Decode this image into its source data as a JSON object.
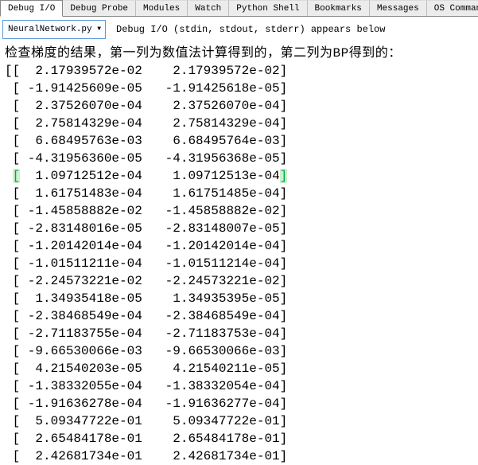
{
  "tabs": {
    "items": [
      {
        "label": "Debug I/O",
        "active": true
      },
      {
        "label": "Debug Probe",
        "active": false
      },
      {
        "label": "Modules",
        "active": false
      },
      {
        "label": "Watch",
        "active": false
      },
      {
        "label": "Python Shell",
        "active": false
      },
      {
        "label": "Bookmarks",
        "active": false
      },
      {
        "label": "Messages",
        "active": false
      },
      {
        "label": "OS Commands",
        "active": false
      }
    ]
  },
  "toolbar": {
    "process_selector": {
      "value": "NeuralNetwork.py (j",
      "arrow": "▼"
    },
    "description": "Debug I/O (stdin, stdout, stderr) appears below"
  },
  "output": {
    "header": "检查梯度的结果，第一列为数值法计算得到的，第二列为BP得到的：",
    "open_first": "[[",
    "open_rest": " [",
    "close": "]",
    "highlight_row_index": 6,
    "rows": [
      [
        "2.17939572e-02",
        "2.17939572e-02"
      ],
      [
        "-1.91425609e-05",
        "-1.91425618e-05"
      ],
      [
        "2.37526070e-04",
        "2.37526070e-04"
      ],
      [
        "2.75814329e-04",
        "2.75814329e-04"
      ],
      [
        "6.68495763e-03",
        "6.68495764e-03"
      ],
      [
        "-4.31956360e-05",
        "-4.31956368e-05"
      ],
      [
        "1.09712512e-04",
        "1.09712513e-04"
      ],
      [
        "1.61751483e-04",
        "1.61751485e-04"
      ],
      [
        "-1.45858882e-02",
        "-1.45858882e-02"
      ],
      [
        "-2.83148016e-05",
        "-2.83148007e-05"
      ],
      [
        "-1.20142014e-04",
        "-1.20142014e-04"
      ],
      [
        "-1.01511211e-04",
        "-1.01511214e-04"
      ],
      [
        "-2.24573221e-02",
        "-2.24573221e-02"
      ],
      [
        "1.34935418e-05",
        "1.34935395e-05"
      ],
      [
        "-2.38468549e-04",
        "-2.38468549e-04"
      ],
      [
        "-2.71183755e-04",
        "-2.71183753e-04"
      ],
      [
        "-9.66530066e-03",
        "-9.66530066e-03"
      ],
      [
        "4.21540203e-05",
        "4.21540211e-05"
      ],
      [
        "-1.38332055e-04",
        "-1.38332054e-04"
      ],
      [
        "-1.91636278e-04",
        "-1.91636277e-04"
      ],
      [
        "5.09347722e-01",
        "5.09347722e-01"
      ],
      [
        "2.65484178e-01",
        "2.65484178e-01"
      ],
      [
        "2.42681734e-01",
        "2.42681734e-01"
      ]
    ]
  },
  "colors": {
    "accent_blue": "#5b9bd5",
    "bracket_highlight_bg": "#cdf2cb",
    "bracket_highlight_fg": "#00a05a",
    "tab_bg": "#ececec",
    "tab_active_bg": "#ffffff",
    "border": "#868686",
    "text": "#000000"
  }
}
